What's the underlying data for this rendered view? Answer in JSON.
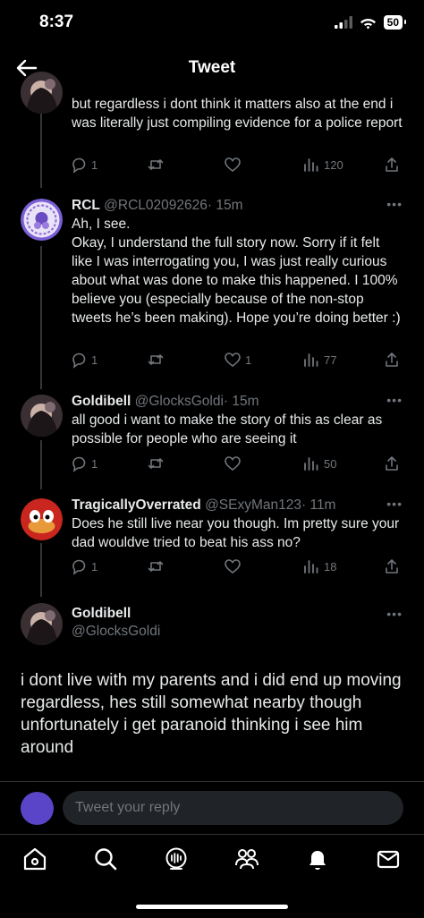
{
  "status_bar": {
    "time": "8:37",
    "battery": "50"
  },
  "header": {
    "title": "Tweet"
  },
  "tweets": [
    {
      "text": "but regardless i dont think it matters also at the end i was literally just compiling evidence for a police report",
      "replies": "1",
      "retweets": "",
      "likes": "",
      "views": "120"
    },
    {
      "name": "RCL",
      "handle": "@RCL02092626",
      "time": "· 15m",
      "text": "Ah, I see.\nOkay, I understand the full story now. Sorry if it felt like I was interrogating you, I was just really curious about what was done to make this happened. I 100% believe you (especially because of the non-stop tweets he’s been making). Hope you’re doing better :)",
      "replies": "1",
      "retweets": "",
      "likes": "1",
      "views": "77"
    },
    {
      "name": "Goldibell",
      "handle": "@GlocksGoldi",
      "time": "· 15m",
      "text": "all good i want to make the story of this as clear as possible for people who are seeing it",
      "replies": "1",
      "retweets": "",
      "likes": "",
      "views": "50"
    },
    {
      "name": "TragicallyOverrated",
      "handle": "@SExyMan123",
      "time": "· 11m",
      "text": "Does he still live near you though. Im pretty sure your dad wouldve tried to beat his ass no?",
      "replies": "1",
      "retweets": "",
      "likes": "",
      "views": "18"
    }
  ],
  "main_tweet": {
    "name": "Goldibell",
    "handle": "@GlocksGoldi",
    "text": "i dont live with my parents and i did end up moving regardless, hes still somewhat nearby though unfortunately i get paranoid thinking i see him around"
  },
  "reply_bar": {
    "placeholder": "Tweet your reply"
  },
  "more_label": "•••",
  "colors": {
    "background": "#000000",
    "text": "#e7e9ea",
    "muted": "#71767b",
    "avatar_purple": "#5a45c8"
  },
  "icons": {
    "back": "arrow-left-icon",
    "reply": "reply-icon",
    "retweet": "retweet-icon",
    "like": "heart-icon",
    "views": "views-icon",
    "share": "share-icon",
    "home": "home-icon",
    "search": "search-icon",
    "spaces": "spaces-icon",
    "communities": "communities-icon",
    "notifications": "bell-icon",
    "messages": "mail-icon"
  }
}
